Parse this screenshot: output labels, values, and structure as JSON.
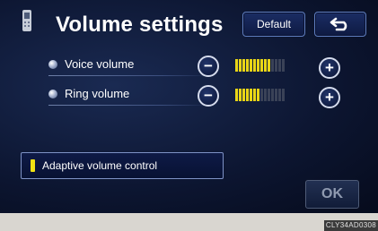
{
  "header": {
    "title": "Volume settings",
    "default_label": "Default",
    "back_icon": "return-arrow-icon",
    "phone_icon": "phone-handset-icon"
  },
  "rows": [
    {
      "label": "Voice volume",
      "level": 10,
      "max": 14
    },
    {
      "label": "Ring volume",
      "level": 7,
      "max": 14
    }
  ],
  "adaptive": {
    "label": "Adaptive volume control",
    "indicator_color": "#f1e213"
  },
  "footer": {
    "ok_label": "OK",
    "image_code": "CLY34AD0308"
  },
  "colors": {
    "meter_on": "#e9d516",
    "meter_off": "#3a4257",
    "screen_bg": "#0c1530"
  }
}
